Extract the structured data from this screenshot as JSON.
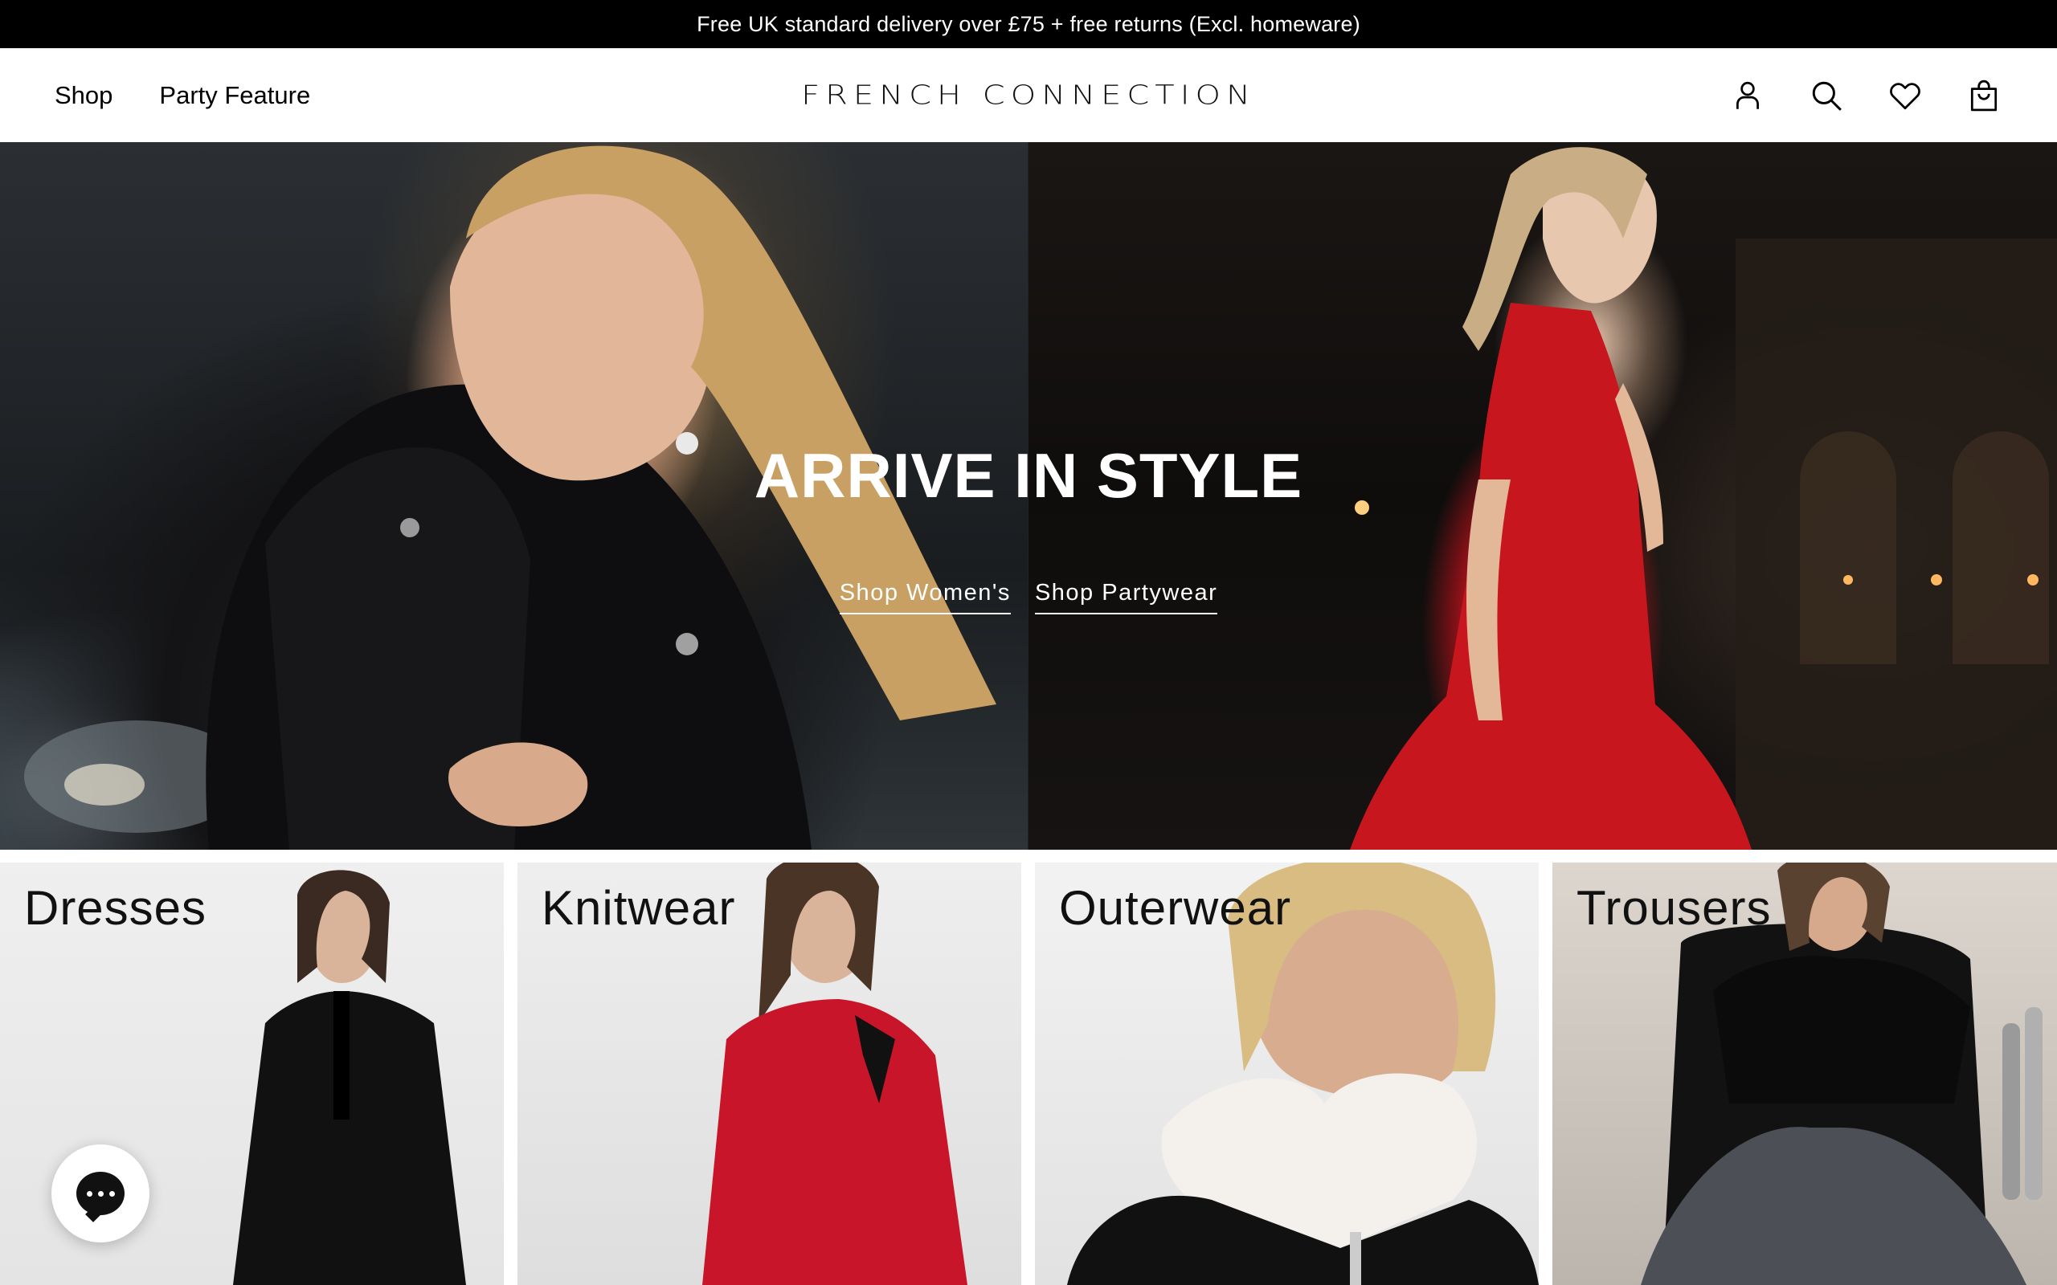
{
  "announcement": "Free UK standard delivery over £75 + free returns (Excl. homeware)",
  "header": {
    "nav": [
      "Shop",
      "Party Feature"
    ],
    "logo": "FRENCH CONNECTION",
    "icons": [
      "account-icon",
      "search-icon",
      "wishlist-heart-icon",
      "shopping-bag-icon"
    ]
  },
  "hero": {
    "title": "ARRIVE IN STYLE",
    "links": [
      "Shop Women's",
      "Shop Partywear"
    ]
  },
  "categories": [
    {
      "label": "Dresses"
    },
    {
      "label": "Knitwear"
    },
    {
      "label": "Outerwear"
    },
    {
      "label": "Trousers"
    }
  ],
  "chat": {
    "icon": "chat-bubble-icon"
  },
  "colors": {
    "announcement_bg": "#000000",
    "hero_dress": "#d41c25",
    "knitwear": "#c8152a"
  }
}
